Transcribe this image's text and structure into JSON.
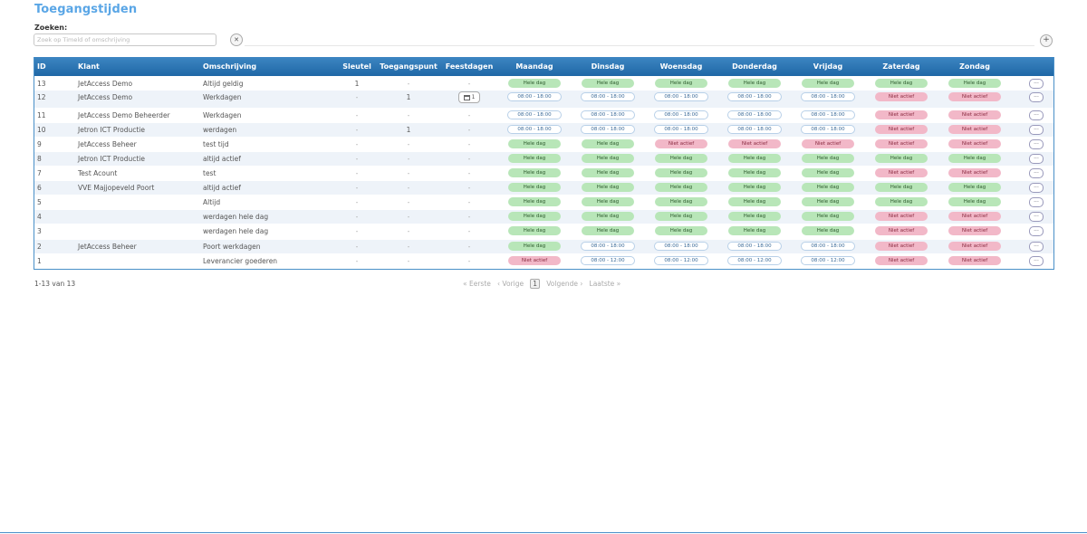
{
  "page": {
    "title": "Toegangstijden"
  },
  "search": {
    "label": "Zoeken:",
    "placeholder": "Zoek op Timeld of omschrijving",
    "clear_icon": "close-icon",
    "add_icon": "plus-icon"
  },
  "table": {
    "headers": [
      "ID",
      "Klant",
      "Omschrijving",
      "Sleutel",
      "Toegangspunt",
      "Feestdagen",
      "Maandag",
      "Dinsdag",
      "Woensdag",
      "Donderdag",
      "Vrijdag",
      "Zaterdag",
      "Zondag"
    ],
    "rows": [
      {
        "id": "13",
        "klant": "JetAccess Demo",
        "omschrijving": "Altijd geldig",
        "sleutel": "1",
        "toegangspunt": "-",
        "feestdagen": "-",
        "days": [
          "Hele dag",
          "Hele dag",
          "Hele dag",
          "Hele dag",
          "Hele dag",
          "Hele dag",
          "Hele dag"
        ]
      },
      {
        "id": "12",
        "klant": "JetAccess Demo",
        "omschrijving": "Werkdagen",
        "sleutel": "-",
        "toegangspunt": "1",
        "feestdagen": "1",
        "days": [
          "08:00 - 18:00",
          "08:00 - 18:00",
          "08:00 - 18:00",
          "08:00 - 18:00",
          "08:00 - 18:00",
          "Niet actief",
          "Niet actief"
        ]
      },
      {
        "id": "11",
        "klant": "JetAccess Demo Beheerder",
        "omschrijving": "Werkdagen",
        "sleutel": "-",
        "toegangspunt": "-",
        "feestdagen": "-",
        "days": [
          "08:00 - 18:00",
          "08:00 - 18:00",
          "08:00 - 18:00",
          "08:00 - 18:00",
          "08:00 - 18:00",
          "Niet actief",
          "Niet actief"
        ]
      },
      {
        "id": "10",
        "klant": "Jetron ICT Productie",
        "omschrijving": "werdagen",
        "sleutel": "-",
        "toegangspunt": "1",
        "feestdagen": "-",
        "days": [
          "08:00 - 18:00",
          "08:00 - 18:00",
          "08:00 - 18:00",
          "08:00 - 18:00",
          "08:00 - 18:00",
          "Niet actief",
          "Niet actief"
        ]
      },
      {
        "id": "9",
        "klant": "JetAccess Beheer",
        "omschrijving": "test tijd",
        "sleutel": "-",
        "toegangspunt": "-",
        "feestdagen": "-",
        "days": [
          "Hele dag",
          "Hele dag",
          "Niet actief",
          "Niet actief",
          "Niet actief",
          "Niet actief",
          "Niet actief"
        ]
      },
      {
        "id": "8",
        "klant": "Jetron ICT Productie",
        "omschrijving": "altijd actief",
        "sleutel": "-",
        "toegangspunt": "-",
        "feestdagen": "-",
        "days": [
          "Hele dag",
          "Hele dag",
          "Hele dag",
          "Hele dag",
          "Hele dag",
          "Hele dag",
          "Hele dag"
        ]
      },
      {
        "id": "7",
        "klant": "Test Acount",
        "omschrijving": "test",
        "sleutel": "-",
        "toegangspunt": "-",
        "feestdagen": "-",
        "days": [
          "Hele dag",
          "Hele dag",
          "Hele dag",
          "Hele dag",
          "Hele dag",
          "Niet actief",
          "Niet actief"
        ]
      },
      {
        "id": "6",
        "klant": "VVE Majjopeveld Poort",
        "omschrijving": "altijd actief",
        "sleutel": "-",
        "toegangspunt": "-",
        "feestdagen": "-",
        "days": [
          "Hele dag",
          "Hele dag",
          "Hele dag",
          "Hele dag",
          "Hele dag",
          "Hele dag",
          "Hele dag"
        ]
      },
      {
        "id": "5",
        "klant": "",
        "omschrijving": "Altijd",
        "sleutel": "-",
        "toegangspunt": "-",
        "feestdagen": "-",
        "days": [
          "Hele dag",
          "Hele dag",
          "Hele dag",
          "Hele dag",
          "Hele dag",
          "Hele dag",
          "Hele dag"
        ]
      },
      {
        "id": "4",
        "klant": "",
        "omschrijving": "werdagen hele dag",
        "sleutel": "-",
        "toegangspunt": "-",
        "feestdagen": "-",
        "days": [
          "Hele dag",
          "Hele dag",
          "Hele dag",
          "Hele dag",
          "Hele dag",
          "Niet actief",
          "Niet actief"
        ]
      },
      {
        "id": "3",
        "klant": "",
        "omschrijving": "werdagen hele dag",
        "sleutel": "-",
        "toegangspunt": "-",
        "feestdagen": "-",
        "days": [
          "Hele dag",
          "Hele dag",
          "Hele dag",
          "Hele dag",
          "Hele dag",
          "Niet actief",
          "Niet actief"
        ]
      },
      {
        "id": "2",
        "klant": "JetAccess Beheer",
        "omschrijving": "Poort werkdagen",
        "sleutel": "-",
        "toegangspunt": "-",
        "feestdagen": "-",
        "days": [
          "Hele dag",
          "08:00 - 18:00",
          "08:00 - 18:00",
          "08:00 - 18:00",
          "08:00 - 18:00",
          "Niet actief",
          "Niet actief"
        ]
      },
      {
        "id": "1",
        "klant": "",
        "omschrijving": "Leverancier goederen",
        "sleutel": "-",
        "toegangspunt": "-",
        "feestdagen": "-",
        "days": [
          "Niet actief",
          "08:00 - 12:00",
          "08:00 - 12:00",
          "08:00 - 12:00",
          "08:00 - 12:00",
          "Niet actief",
          "Niet actief"
        ]
      }
    ],
    "more_label": "...",
    "calendar_icon": "calendar-icon"
  },
  "footer": {
    "count": "1-13 van 13",
    "first": "« Eerste",
    "prev": "‹ Vorige",
    "current": "1",
    "next": "Volgende ›",
    "last": "Laatste »"
  },
  "colors": {
    "accent": "#3d86c2",
    "title": "#5aa6e6",
    "green": "#b8e6b8",
    "red": "#f2b8c8"
  }
}
